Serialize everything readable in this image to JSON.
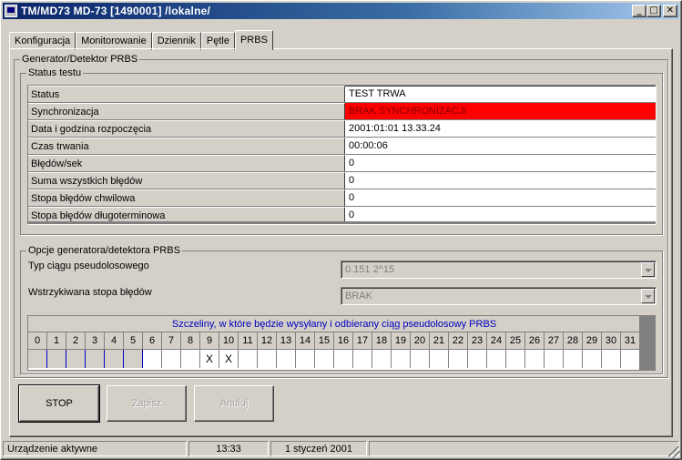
{
  "window": {
    "title": "TM/MD73 MD-73    [1490001]   /lokalne/",
    "min_glyph": "_",
    "max_glyph": "□",
    "close_glyph": "✕"
  },
  "tabs": [
    {
      "label": "Konfiguracja",
      "active": false
    },
    {
      "label": "Monitorowanie",
      "active": false
    },
    {
      "label": "Dziennik",
      "active": false
    },
    {
      "label": "Pętle",
      "active": false
    },
    {
      "label": "PRBS",
      "active": true
    }
  ],
  "generator": {
    "group_label": "Generator/Detektor PRBS",
    "status_group_label": "Status testu",
    "status_rows": [
      {
        "key": "Status",
        "value": "TEST TRWA",
        "highlight": false
      },
      {
        "key": "Synchronizacja",
        "value": "BRAK SYNCHRONIZACJI",
        "highlight": true
      },
      {
        "key": "Data i godzina rozpoczęcia",
        "value": "2001:01:01   13.33.24",
        "highlight": false
      },
      {
        "key": "Czas trwania",
        "value": "00:00:06",
        "highlight": false
      },
      {
        "key": "Błędów/sek",
        "value": "0",
        "highlight": false
      },
      {
        "key": "Suma wszystkich błędów",
        "value": "0",
        "highlight": false
      },
      {
        "key": "Stopa błędów chwilowa",
        "value": "0",
        "highlight": false
      },
      {
        "key": "Stopa błędów długoterminowa",
        "value": "0",
        "highlight": false
      }
    ],
    "highlight_color": "#ff0000"
  },
  "options": {
    "group_label": "Opcje generatora/detektora PRBS",
    "sequence_type_label": "Typ ciągu pseudolosowego",
    "sequence_type_value": "0.151 2^15",
    "error_rate_label": "Wstrzykiwana stopa błędów",
    "error_rate_value": "BRAK",
    "slots_title": "Szczeliny, w które będzie wysyłany i odbierany ciąg pseudolosowy PRBS",
    "slots": [
      "0",
      "1",
      "2",
      "3",
      "4",
      "5",
      "6",
      "7",
      "8",
      "9",
      "10",
      "11",
      "12",
      "13",
      "14",
      "15",
      "16",
      "17",
      "18",
      "19",
      "20",
      "21",
      "22",
      "23",
      "24",
      "25",
      "26",
      "27",
      "28",
      "29",
      "30",
      "31"
    ],
    "slot_marks": [
      "",
      "",
      "",
      "",
      "",
      "",
      "",
      "",
      "",
      "X",
      "X",
      "",
      "",
      "",
      "",
      "",
      "",
      "",
      "",
      "",
      "",
      "",
      "",
      "",
      "",
      "",
      "",
      "",
      "",
      "",
      "",
      ""
    ],
    "disabled_slots": 6
  },
  "buttons": {
    "stop": "STOP",
    "save": "Zapisz",
    "cancel": "Anuluj"
  },
  "statusbar": {
    "device": "Urządzenie aktywne",
    "time": "13:33",
    "date": "1 styczeń 2001"
  }
}
